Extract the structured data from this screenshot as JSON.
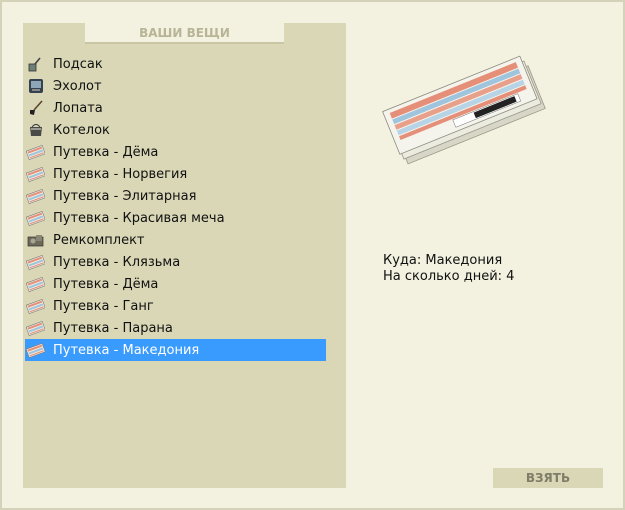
{
  "panel": {
    "title": "ВАШИ ВЕЩИ"
  },
  "items": [
    {
      "label": "Подсак",
      "icon": "landing-net-icon"
    },
    {
      "label": "Эхолот",
      "icon": "echo-sounder-icon"
    },
    {
      "label": "Лопата",
      "icon": "shovel-icon"
    },
    {
      "label": "Котелок",
      "icon": "pot-icon"
    },
    {
      "label": "Путевка - Дёма",
      "icon": "voucher-icon"
    },
    {
      "label": "Путевка - Норвегия",
      "icon": "voucher-icon"
    },
    {
      "label": "Путевка - Элитарная",
      "icon": "voucher-icon"
    },
    {
      "label": "Путевка - Красивая меча",
      "icon": "voucher-icon"
    },
    {
      "label": "Ремкомплект",
      "icon": "repair-kit-icon"
    },
    {
      "label": "Путевка - Клязьма",
      "icon": "voucher-icon"
    },
    {
      "label": "Путевка - Дёма",
      "icon": "voucher-icon"
    },
    {
      "label": "Путевка - Ганг",
      "icon": "voucher-icon"
    },
    {
      "label": "Путевка - Парана",
      "icon": "voucher-icon"
    },
    {
      "label": "Путевка - Македония",
      "icon": "voucher-icon",
      "selected": true
    }
  ],
  "details": {
    "destination": "Куда: Македония",
    "days": "На сколько дней: 4"
  },
  "take_button": {
    "label": "ВЗЯТЬ"
  },
  "colors": {
    "background": "#f3f1df",
    "panel": "#d9d7b6",
    "selection": "#3a9bff"
  }
}
